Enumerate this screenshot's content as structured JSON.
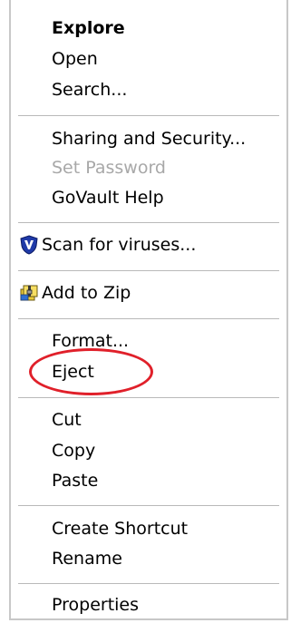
{
  "menu": {
    "explore": "Explore",
    "open": "Open",
    "search": "Search...",
    "sharing_security": "Sharing and Security...",
    "set_password": "Set Password",
    "govault_help": "GoVault Help",
    "scan_viruses": "Scan for viruses...",
    "add_to_zip": "Add to Zip",
    "format": "Format...",
    "eject": "Eject",
    "cut": "Cut",
    "copy": "Copy",
    "paste": "Paste",
    "create_shortcut": "Create Shortcut",
    "rename": "Rename",
    "properties": "Properties"
  },
  "icons": {
    "scan": "mcafee-shield-icon",
    "zip": "zip-archive-icon"
  },
  "colors": {
    "disabled_text": "#a8a8a8",
    "annotation_ellipse": "#e0202a",
    "shield_blue": "#1f3aa8"
  }
}
